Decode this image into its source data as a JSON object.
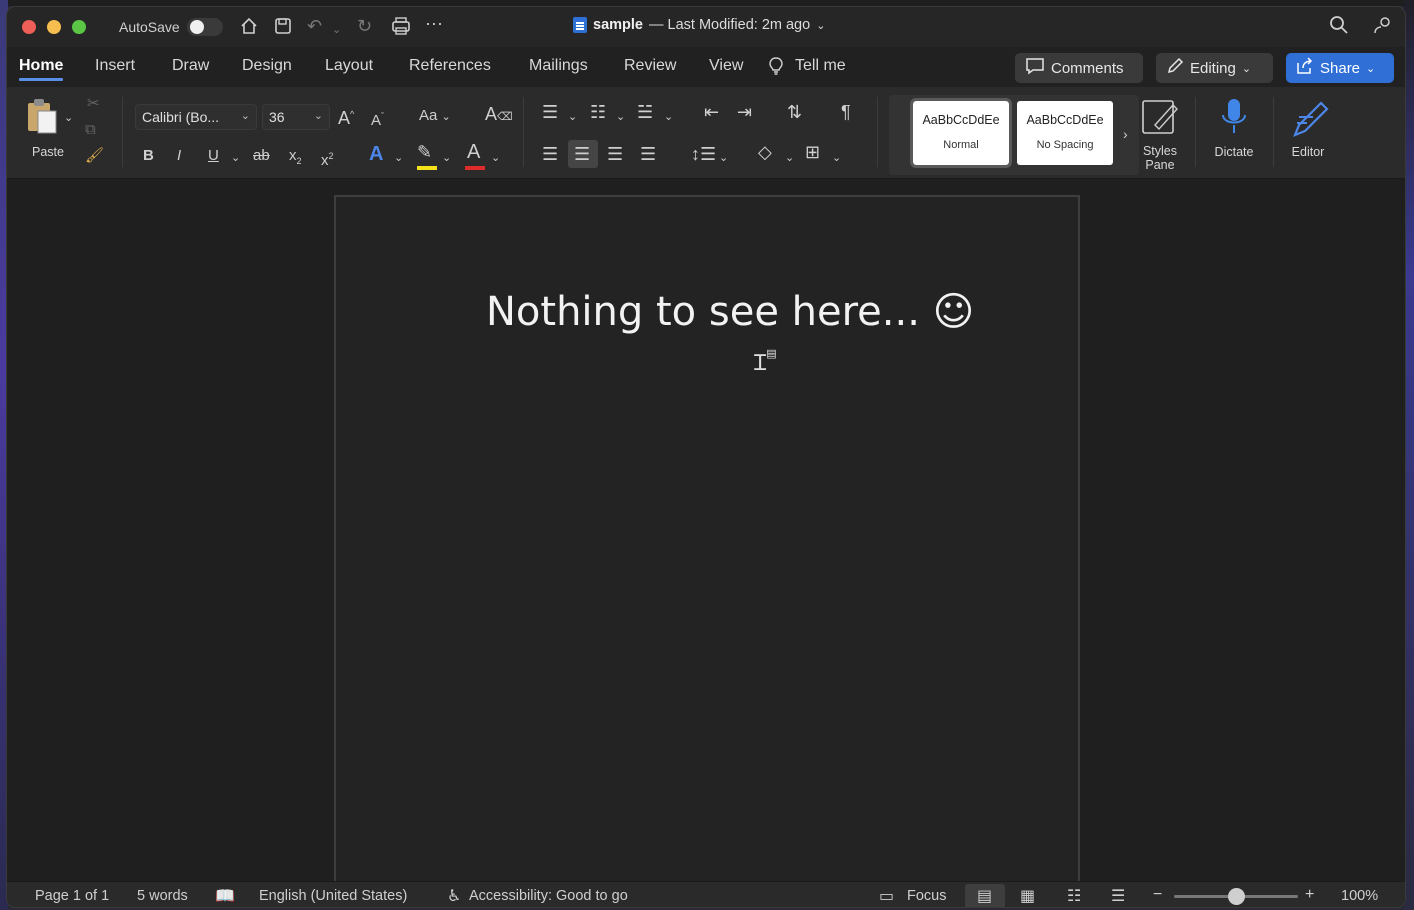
{
  "titlebar": {
    "autosave_label": "AutoSave",
    "doc_name": "sample",
    "doc_status": "— Last Modified: 2m ago",
    "icons": [
      "home-icon",
      "save-icon",
      "undo-icon",
      "redo-icon",
      "print-icon",
      "more-icon",
      "search-icon",
      "share-people-icon"
    ]
  },
  "tabs": [
    "Home",
    "Insert",
    "Draw",
    "Design",
    "Layout",
    "References",
    "Mailings",
    "Review",
    "View"
  ],
  "tell_me": "Tell me",
  "header_buttons": {
    "comments": "Comments",
    "editing": "Editing",
    "share": "Share"
  },
  "ribbon": {
    "paste_label": "Paste",
    "font_name": "Calibri (Bo...",
    "font_size": "36",
    "change_case": "Aa",
    "bold": "B",
    "italic": "I",
    "underline": "U",
    "strikethrough": "ab",
    "subscript": "x",
    "superscript": "x",
    "font_color_letter": "A",
    "styles": [
      {
        "sample": "AaBbCcDdEe",
        "name": "Normal"
      },
      {
        "sample": "AaBbCcDdEe",
        "name": "No Spacing"
      }
    ],
    "styles_pane": "Styles\nPane",
    "dictate": "Dictate",
    "editor": "Editor",
    "highlight_color": "#f3e21b",
    "font_color": "#e02b2b",
    "accent_color": "#2f6fd6"
  },
  "document": {
    "text": "Nothing to see here... ☺"
  },
  "statusbar": {
    "page": "Page 1 of 1",
    "words": "5 words",
    "language": "English (United States)",
    "accessibility": "Accessibility: Good to go",
    "focus": "Focus",
    "zoom": "100%",
    "zoom_value": 1.0
  }
}
